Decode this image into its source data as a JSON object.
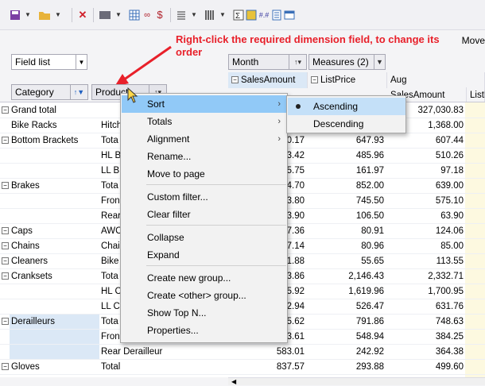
{
  "toolbar": {
    "buttons": [
      "save-icon",
      "open-folder-icon",
      "delete-icon",
      "chart-icon",
      "grid-icon",
      "formula-icon",
      "currency-icon",
      "list-icon",
      "bar-icon",
      "sum-icon",
      "table-icon",
      "number-format-icon",
      "report-icon",
      "window-icon"
    ],
    "more_label": "Move"
  },
  "annotation": {
    "text": "Right-click the required dimension field, to change its order",
    "color": "#e8202a"
  },
  "field_list": {
    "label": "Field list"
  },
  "row_fields": {
    "category": "Category",
    "product": "Product"
  },
  "column_fields": {
    "month": "Month",
    "measures": "Measures (2)"
  },
  "columns": {
    "sales_amount": "SalesAmount",
    "list_price": "ListPrice",
    "aug": "Aug",
    "aug_sales": "SalesAmount",
    "aug_list": "ListPr"
  },
  "rows": [
    {
      "category": "Grand total",
      "expand": true,
      "product": "",
      "c1": "",
      "c2": "",
      "c3": "327,030.83"
    },
    {
      "category": "Bike Racks",
      "expand": false,
      "product": "Hitch",
      "c1": "",
      "c2": "",
      "c3": "1,368.00"
    },
    {
      "category": "Bottom Brackets",
      "expand": true,
      "product": "Tota",
      "c1": "0.17",
      "c2": "647.93",
      "c3": "607.44"
    },
    {
      "category": "",
      "expand": false,
      "product": "HL B",
      "c1": "3.42",
      "c2": "485.96",
      "c3": "510.26"
    },
    {
      "category": "",
      "expand": false,
      "product": "LL B",
      "c1": "5.75",
      "c2": "161.97",
      "c3": "97.18"
    },
    {
      "category": "Brakes",
      "expand": true,
      "product": "Tota",
      "c1": "4.70",
      "c2": "852.00",
      "c3": "639.00"
    },
    {
      "category": "",
      "expand": false,
      "product": "Fron",
      "c1": "3.80",
      "c2": "745.50",
      "c3": "575.10"
    },
    {
      "category": "",
      "expand": false,
      "product": "Rear",
      "c1": "3.90",
      "c2": "106.50",
      "c3": "63.90"
    },
    {
      "category": "Caps",
      "expand": true,
      "product": "AWC",
      "c1": "7.36",
      "c2": "80.91",
      "c3": "124.06"
    },
    {
      "category": "Chains",
      "expand": true,
      "product": "Chai",
      "c1": "7.14",
      "c2": "80.96",
      "c3": "85.00"
    },
    {
      "category": "Cleaners",
      "expand": true,
      "product": "Bike",
      "c1": "1.88",
      "c2": "55.65",
      "c3": "113.55"
    },
    {
      "category": "Cranksets",
      "expand": true,
      "product": "Tota",
      "c1": "3.86",
      "c2": "2,146.43",
      "c3": "2,332.71"
    },
    {
      "category": "",
      "expand": false,
      "product": "HL C",
      "c1": "5.92",
      "c2": "1,619.96",
      "c3": "1,700.95"
    },
    {
      "category": "",
      "expand": false,
      "product": "LL C",
      "c1": "2.94",
      "c2": "526.47",
      "c3": "631.76"
    },
    {
      "category": "Derailleurs",
      "expand": true,
      "product": "Tota",
      "c1": "5.62",
      "c2": "791.86",
      "c3": "748.63"
    },
    {
      "category": "",
      "expand": false,
      "product": "Fron",
      "c1": "3.61",
      "c2": "548.94",
      "c3": "384.25"
    },
    {
      "category": "",
      "expand": false,
      "product": "Rear Derailleur",
      "c1": "583.01",
      "c2": "242.92",
      "c3": "364.38"
    },
    {
      "category": "Gloves",
      "expand": true,
      "product": "Total",
      "c1": "837.57",
      "c2": "293.88",
      "c3": "499.60"
    }
  ],
  "context_menu": {
    "items": [
      {
        "label": "Sort",
        "submenu": true
      },
      {
        "label": "Totals",
        "submenu": true
      },
      {
        "label": "Alignment",
        "submenu": true
      },
      {
        "label": "Rename...",
        "submenu": false
      },
      {
        "label": "Move to page",
        "submenu": false
      },
      {
        "label": "Custom filter...",
        "submenu": false
      },
      {
        "label": "Clear filter",
        "submenu": false
      },
      {
        "label": "Collapse",
        "submenu": false
      },
      {
        "label": "Expand",
        "submenu": false
      },
      {
        "label": "Create new group...",
        "submenu": false
      },
      {
        "label": "Create <other> group...",
        "submenu": false
      },
      {
        "label": "Show Top N...",
        "submenu": false
      },
      {
        "label": "Properties...",
        "submenu": false
      }
    ]
  },
  "sort_submenu": {
    "ascending": "Ascending",
    "descending": "Descending",
    "selected": "Ascending"
  },
  "colors": {
    "highlight": "#91c9f7",
    "selected_row": "#dbe8f6",
    "year_column": "#fdf9e0"
  }
}
